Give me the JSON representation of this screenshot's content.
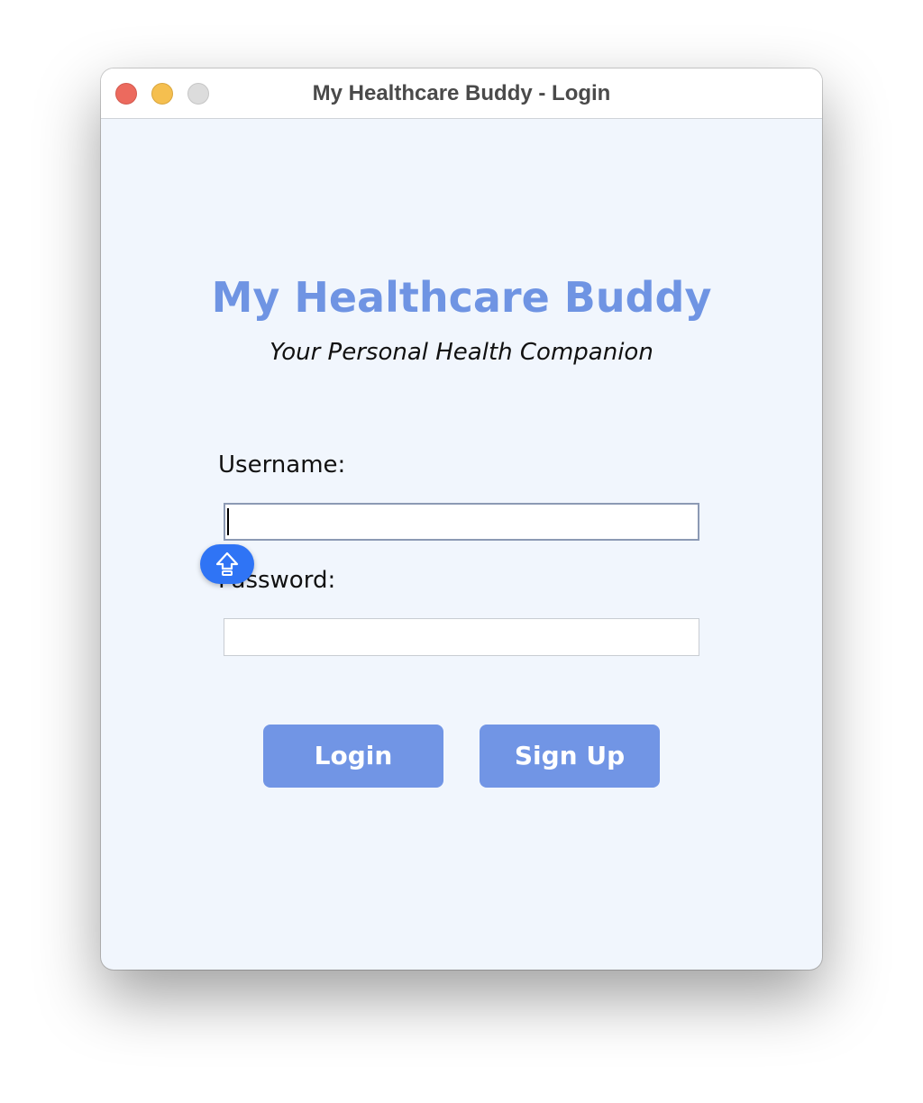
{
  "window": {
    "title": "My Healthcare Buddy - Login"
  },
  "header": {
    "app_title": "My Healthcare Buddy",
    "subtitle": "Your Personal Health Companion"
  },
  "form": {
    "username_label": "Username:",
    "username_value": "",
    "password_label": "Password:",
    "password_value": ""
  },
  "actions": {
    "login_label": "Login",
    "signup_label": "Sign Up"
  },
  "indicators": {
    "caps_lock_icon": "caps-lock-arrow-icon"
  },
  "colors": {
    "accent": "#7195e5",
    "title": "#6f94e3",
    "background": "#f1f6fd",
    "caps_badge": "#2f74f5"
  }
}
